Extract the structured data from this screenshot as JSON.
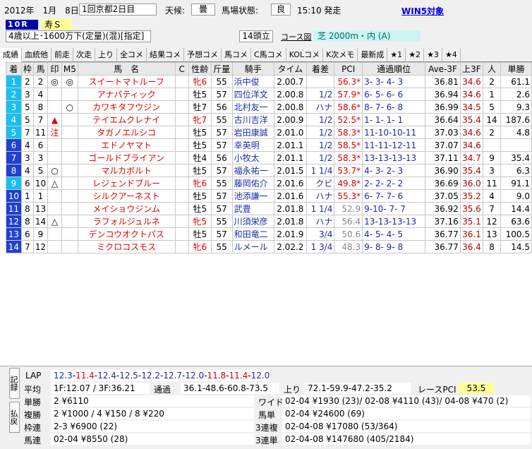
{
  "header": {
    "date": "2012年　1月　8日",
    "meeting": "1回京都2日目",
    "weather_label": "天候:",
    "weather": "曇",
    "track_label": "馬場状態:",
    "track": "良",
    "post_time": "15:10 発走",
    "win5": "WIN5対象",
    "race_no": "10R",
    "race_name": "寿Ｓ",
    "conditions": "4歳以上･1600万下(定量)(混)[指定]",
    "runners": "14頭立",
    "course_link": "コース図",
    "course": "芝 2000m・内 (A)"
  },
  "tabs": [
    "成績",
    "血統他",
    "前走",
    "次走",
    "上り",
    "全コメ",
    "結果コメ",
    "予想コメ",
    "馬コメ",
    "C馬コメ",
    "KOLコメ",
    "K次メモ",
    "最新成",
    "★1",
    "★2",
    "★3",
    "★4"
  ],
  "columns": [
    "着",
    "枠",
    "馬",
    "印",
    "M5",
    "馬　名",
    "C",
    "性齢",
    "斤量",
    "騎手",
    "タイム",
    "着差",
    "PCI",
    "通過順位",
    "Ave-3F",
    "上3F",
    "人",
    "単勝"
  ],
  "rows": [
    {
      "pos": "1",
      "waku": "2",
      "uma": "2",
      "mark": "◎",
      "m5": "◎",
      "name": "スイートマトルーフ",
      "sex": "牝6",
      "kin": "55",
      "jockey": "浜中俊",
      "time": "2.00.7",
      "margin": "",
      "pci": "56.3",
      "pci_star": "*",
      "pass": "3-  3-  4-  3",
      "ave": "36.81",
      "last3f": "34.6",
      "ninki": "2",
      "odds": "61.1",
      "row_color": "#18c0f0",
      "sex_red": true,
      "l3_hl": "",
      "n_hl": "",
      "o_hl": ""
    },
    {
      "pos": "2",
      "waku": "3",
      "uma": "4",
      "mark": "",
      "m5": "",
      "name": "アナパティック",
      "sex": "牡5",
      "kin": "57",
      "jockey": "四位洋文",
      "time": "2.00.8",
      "margin": "1/2",
      "pci": "57.9",
      "pci_star": "*",
      "pass": "6-  5-  6-  6",
      "ave": "36.94",
      "last3f": "34.6",
      "ninki": "1",
      "odds": "2.6",
      "row_color": "#18c0f0",
      "sex_red": false,
      "l3_hl": "c",
      "n_hl": "y",
      "o_hl": "y"
    },
    {
      "pos": "3",
      "waku": "5",
      "uma": "8",
      "mark": "",
      "m5": "○",
      "name": "カワキタフウジン",
      "sex": "牡7",
      "kin": "56",
      "jockey": "北村友一",
      "time": "2.00.8",
      "margin": "ハナ",
      "pci": "58.6",
      "pci_star": "*",
      "pass": "8-  7-  6-  8",
      "ave": "36.99",
      "last3f": "34.5",
      "ninki": "5",
      "odds": "9.3",
      "row_color": "#18c0f0",
      "sex_red": false,
      "l3_hl": "y",
      "n_hl": "",
      "o_hl": ""
    },
    {
      "pos": "4",
      "waku": "5",
      "uma": "7",
      "mark": "▲",
      "m5": "",
      "name": "テイエムクレナイ",
      "sex": "牝7",
      "kin": "55",
      "jockey": "古川吉洋",
      "time": "2.00.9",
      "margin": "1/2",
      "pci": "52.5",
      "pci_star": "*",
      "pass": "1-  1-  1-  1",
      "ave": "36.64",
      "last3f": "35.4",
      "ninki": "14",
      "odds": "187.6",
      "row_color": "#18c0f0",
      "sex_red": true,
      "l3_hl": "",
      "n_hl": "",
      "o_hl": ""
    },
    {
      "pos": "5",
      "waku": "7",
      "uma": "11",
      "mark": "注",
      "m5": "",
      "name": "タガノエルシコ",
      "sex": "牡5",
      "kin": "57",
      "jockey": "岩田康誠",
      "time": "2.01.0",
      "margin": "1/2",
      "pci": "58.3",
      "pci_star": "*",
      "pass": "11-10-10-11",
      "ave": "37.03",
      "last3f": "34.6",
      "ninki": "2",
      "odds": "4.8",
      "row_color": "#18c0f0",
      "sex_red": false,
      "l3_hl": "c",
      "n_hl": "c",
      "o_hl": "c"
    },
    {
      "pos": "6",
      "waku": "4",
      "uma": "6",
      "mark": "",
      "m5": "",
      "name": "エドノヤマト",
      "sex": "牡5",
      "kin": "57",
      "jockey": "幸英明",
      "time": "2.01.1",
      "margin": "1/2",
      "pci": "58.5",
      "pci_star": "*",
      "pass": "11-11-12-11",
      "ave": "37.07",
      "last3f": "34.6",
      "ninki": "",
      "odds": "",
      "row_color": "#2040d0",
      "sex_red": false,
      "l3_hl": "c",
      "n_hl": "",
      "o_hl": ""
    },
    {
      "pos": "7",
      "waku": "3",
      "uma": "3",
      "mark": "",
      "m5": "",
      "name": "ゴールドブライアン",
      "sex": "牡4",
      "kin": "56",
      "jockey": "小牧太",
      "time": "2.01.1",
      "margin": "1/2",
      "pci": "58.3",
      "pci_star": "*",
      "pass": "13-13-13-13",
      "ave": "37.11",
      "last3f": "34.7",
      "ninki": "9",
      "odds": "35.4",
      "row_color": "#2040d0",
      "sex_red": false,
      "l3_hl": "",
      "n_hl": "",
      "o_hl": ""
    },
    {
      "pos": "8",
      "waku": "4",
      "uma": "5",
      "mark": "○",
      "m5": "",
      "name": "マルカボルト",
      "sex": "牡5",
      "kin": "57",
      "jockey": "福永祐一",
      "time": "2.01.5",
      "margin": "1 1/4",
      "pci": "53.7",
      "pci_star": "*",
      "pass": "4-  3-  2-  3",
      "ave": "36.90",
      "last3f": "35.4",
      "ninki": "3",
      "odds": "6.3",
      "row_color": "#2040d0",
      "sex_red": false,
      "l3_hl": "",
      "n_hl": "g",
      "o_hl": "g"
    },
    {
      "pos": "9",
      "waku": "6",
      "uma": "10",
      "mark": "△",
      "m5": "",
      "name": "レジェンドブルー",
      "sex": "牝6",
      "kin": "55",
      "jockey": "藤岡佑介",
      "time": "2.01.6",
      "margin": "クビ",
      "pci": "49.8",
      "pci_star": "*",
      "pass": "2-  2-  2-  2",
      "ave": "36.69",
      "last3f": "36.0",
      "ninki": "11",
      "odds": "91.1",
      "row_color": "#18c0f0",
      "sex_red": true,
      "l3_hl": "",
      "n_hl": "",
      "o_hl": ""
    },
    {
      "pos": "10",
      "waku": "1",
      "uma": "1",
      "mark": "",
      "m5": "",
      "name": "シルクアーネスト",
      "sex": "牡5",
      "kin": "57",
      "jockey": "池添謙一",
      "time": "2.01.6",
      "margin": "ハナ",
      "pci": "55.3",
      "pci_star": "*",
      "pass": "6-  7-  7-  6",
      "ave": "37.05",
      "last3f": "35.2",
      "ninki": "4",
      "odds": "9.0",
      "row_color": "#2040d0",
      "sex_red": false,
      "l3_hl": "",
      "n_hl": "",
      "o_hl": ""
    },
    {
      "pos": "11",
      "waku": "8",
      "uma": "13",
      "mark": "",
      "m5": "",
      "name": "メイショウジンム",
      "sex": "牡5",
      "kin": "57",
      "jockey": "武豊",
      "time": "2.01.8",
      "margin": "1 1/4",
      "pci": "52.9",
      "pci_star": "",
      "pass": "9-10-  7-  7",
      "ave": "36.92",
      "last3f": "35.6",
      "ninki": "7",
      "odds": "14.4",
      "row_color": "#2040d0",
      "sex_red": false,
      "l3_hl": "",
      "n_hl": "",
      "o_hl": ""
    },
    {
      "pos": "12",
      "waku": "8",
      "uma": "14",
      "mark": "△",
      "m5": "",
      "name": "ラフォルジュルネ",
      "sex": "牝5",
      "kin": "55",
      "jockey": "川須栄彦",
      "time": "2.01.8",
      "margin": "ハナ",
      "pci": "56.4",
      "pci_star": "",
      "pass": "13-13-13-13",
      "ave": "37.16",
      "last3f": "35.1",
      "ninki": "12",
      "odds": "63.6",
      "row_color": "#2040d0",
      "sex_red": true,
      "l3_hl": "",
      "n_hl": "",
      "o_hl": ""
    },
    {
      "pos": "13",
      "waku": "6",
      "uma": "9",
      "mark": "",
      "m5": "",
      "name": "デンコウオクトパス",
      "sex": "牡5",
      "kin": "57",
      "jockey": "和田竜二",
      "time": "2.01.9",
      "margin": "3/4",
      "pci": "50.6",
      "pci_star": "",
      "pass": "4-  5-  4-  5",
      "ave": "36.77",
      "last3f": "36.1",
      "ninki": "13",
      "odds": "100.5",
      "row_color": "#2040d0",
      "sex_red": false,
      "l3_hl": "",
      "n_hl": "",
      "o_hl": ""
    },
    {
      "pos": "14",
      "waku": "7",
      "uma": "12",
      "mark": "",
      "m5": "",
      "name": "ミクロコスモス",
      "sex": "牝6",
      "kin": "55",
      "jockey": "ルメール",
      "time": "2.02.2",
      "margin": "1 3/4",
      "pci": "48.3",
      "pci_star": "",
      "pass": "9-  8-  9-  8",
      "ave": "36.77",
      "last3f": "36.4",
      "ninki": "8",
      "odds": "14.5",
      "row_color": "#2040d0",
      "sex_red": true,
      "l3_hl": "",
      "n_hl": "",
      "o_hl": ""
    }
  ],
  "bottom": {
    "side1": "記録",
    "side2": "払戻",
    "lap_label": "LAP",
    "laps": [
      "12.3",
      "11.4",
      "12.4",
      "12.5",
      "12.2",
      "12.7",
      "12.0",
      "11.8",
      "11.4",
      "12.0"
    ],
    "lap_colors": [
      "#1a2ca8",
      "#e00000",
      "#1a2ca8",
      "#1a2ca8",
      "#1a2ca8",
      "#1a2ca8",
      "#1a2ca8",
      "#e00000",
      "#e00000",
      "#1a2ca8"
    ],
    "avg_label": "平均",
    "avg": "1F:12.07 / 3F:36.21",
    "pass_label": "通過",
    "pass": "36.1-48.6-60.8-73.5",
    "agari_label": "上り",
    "agari": "72.1-59.9-47.2-35.2",
    "race_pci_label": "レースPCI",
    "race_pci": "53.5",
    "tansho_label": "単勝",
    "tansho": "2 ¥6110",
    "fukusho_label": "複勝",
    "fukusho": "2 ¥1000 / 4 ¥150 / 8 ¥220",
    "wakuren_label": "枠連",
    "wakuren": "2-3 ¥6900 (22)",
    "umaren_label": "馬連",
    "umaren": "02-04 ¥8550 (28)",
    "wide_label": "ワイド",
    "wide": "02-04 ¥1930 (23)/ 02-08 ¥4110 (43)/ 04-08 ¥470 (2)",
    "umatan_label": "馬単",
    "umatan": "02-04 ¥24600 (69)",
    "sanfuku_label": "3連複",
    "sanfuku": "02-04-08 ¥17080 (53/364)",
    "santan_label": "3連単",
    "santan": "02-04-08 ¥147680 (405/2184)"
  }
}
